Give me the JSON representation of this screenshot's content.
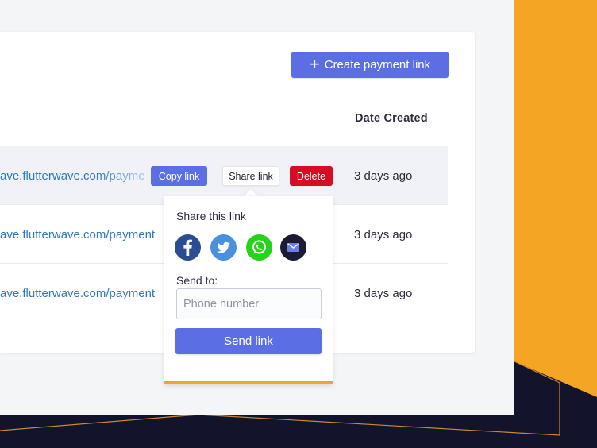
{
  "colors": {
    "accent": "#5b6ee3",
    "danger": "#d60d22",
    "brand_orange": "#f4a523",
    "brand_navy": "#13132c",
    "link": "#2f78c2"
  },
  "header": {
    "create_label": "Create payment link",
    "create_icon": "plus-icon"
  },
  "table": {
    "column_date": "Date Created",
    "rows": [
      {
        "link": "ave.flutterwave.com/payment",
        "date": "3 days ago"
      },
      {
        "link": "ave.flutterwave.com/payment",
        "date": "3 days ago"
      },
      {
        "link": "ave.flutterwave.com/payment",
        "date": "3 days ago"
      }
    ]
  },
  "actions": {
    "copy": "Copy link",
    "share": "Share link",
    "delete": "Delete"
  },
  "share_popover": {
    "title": "Share this link",
    "icons": [
      "facebook-icon",
      "twitter-icon",
      "whatsapp-icon",
      "email-icon"
    ],
    "send_label": "Send to:",
    "phone_placeholder": "Phone number",
    "send_button": "Send link"
  }
}
